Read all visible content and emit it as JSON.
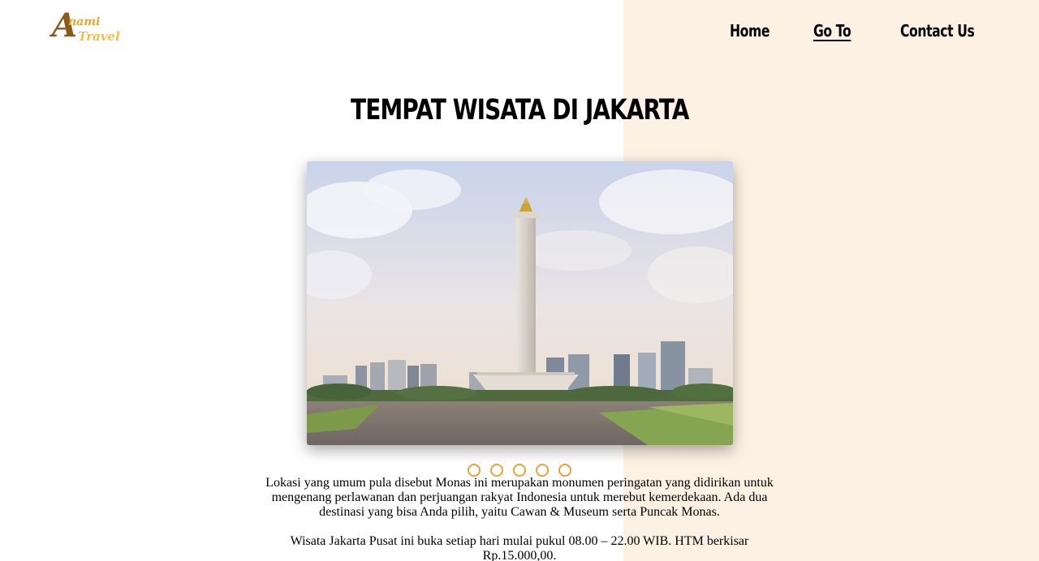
{
  "brand": {
    "logo_line1": "nami",
    "logo_line2": "Travel",
    "logo_letter": "A",
    "colors": {
      "dark": "#8a5a1c",
      "gold": "#e3a63a",
      "light_gold": "#f0c04a"
    }
  },
  "nav": {
    "items": [
      {
        "label": "Home"
      },
      {
        "label": "Go To",
        "active": true
      },
      {
        "label": "Contact Us"
      }
    ]
  },
  "page": {
    "title": "TEMPAT WISATA DI JAKARTA",
    "background_right": "#fdf1e3"
  },
  "slider": {
    "current_slide": "Monas (Monumen Nasional)",
    "dot_count": 5,
    "dot_color": "#f0a03a"
  },
  "description": {
    "paragraph1": "Lokasi yang umum pula disebut Monas ini merupakan monumen peringatan yang didirikan untuk mengenang perlawanan dan perjuangan rakyat Indonesia untuk merebut kemerdekaan. Ada dua destinasi yang bisa Anda pilih, yaitu Cawan & Museum serta Puncak Monas.",
    "paragraph2": "Wisata Jakarta Pusat ini buka setiap hari mulai pukul 08.00 – 22.00 WIB. HTM berkisar Rp.15.000,00."
  }
}
